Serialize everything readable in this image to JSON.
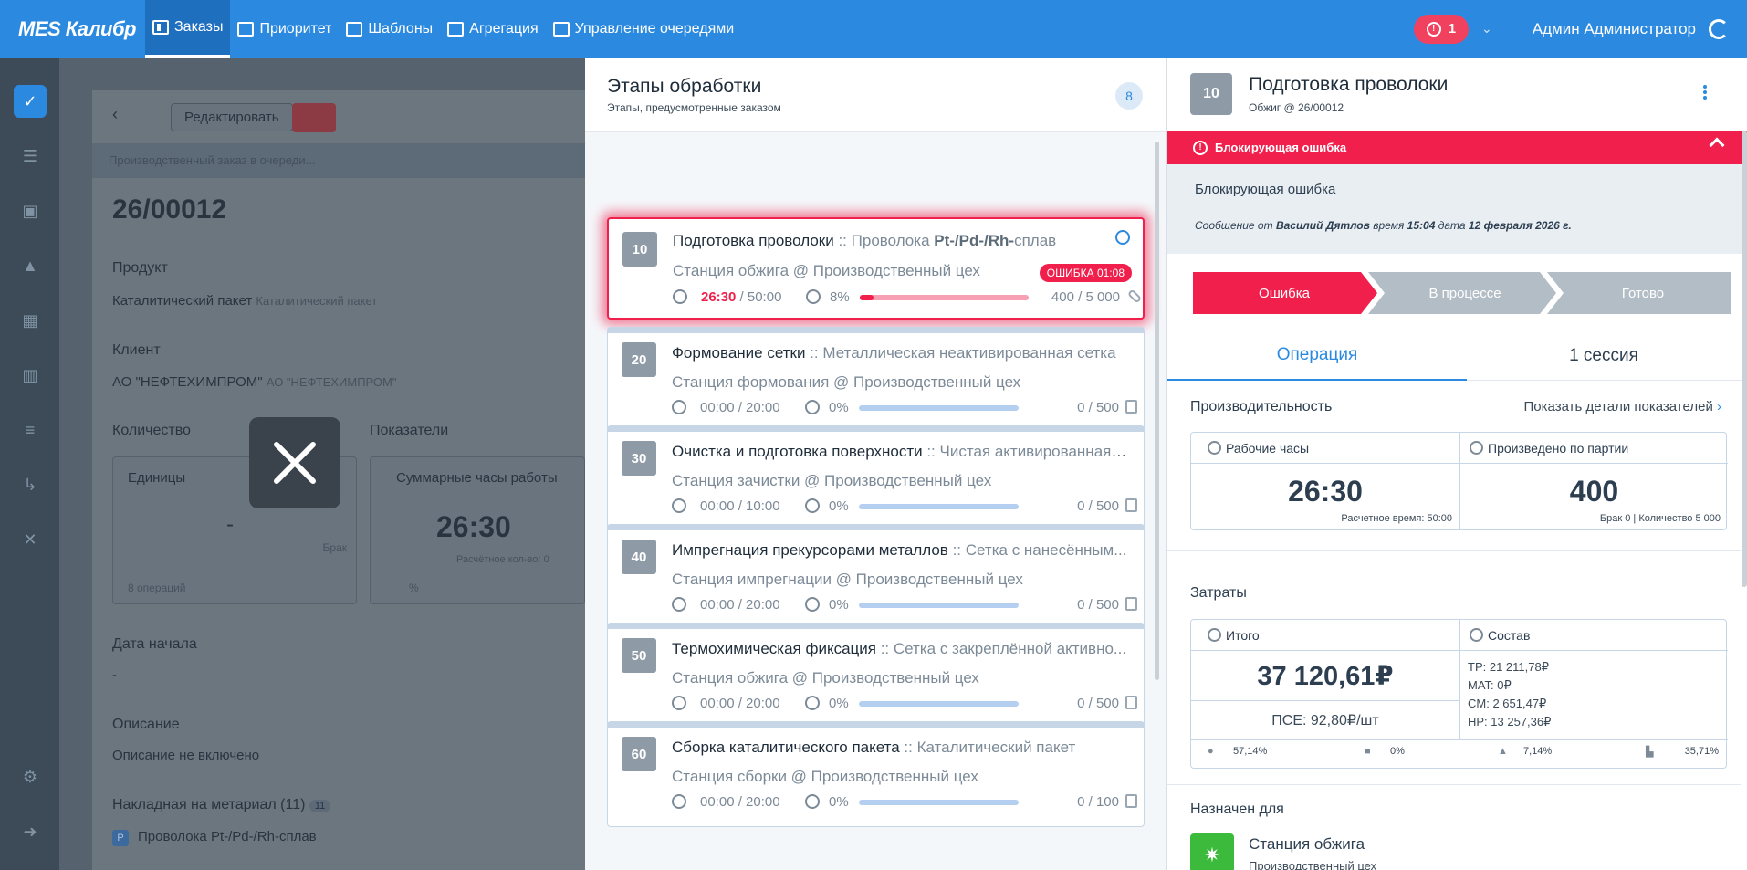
{
  "topbar": {
    "brand": "MES Калибр",
    "nav": [
      {
        "label": "Заказы",
        "active": true
      },
      {
        "label": "Приоритет"
      },
      {
        "label": "Шаблоны"
      },
      {
        "label": "Агрегация"
      },
      {
        "label": "Управление очередями"
      }
    ],
    "alert_count": "1",
    "user": "Админ Администратор"
  },
  "background": {
    "edit_label": "Редактировать",
    "status_band": "Производственный заказ в очереди...",
    "order_no": "26/00012",
    "product_label": "Продукт",
    "product_value": "Каталитический пакет",
    "product_value_muted": "Каталитический пакет",
    "client_label": "Клиент",
    "client_value": "АО \"НЕФТЕХИМПРОМ\"",
    "client_value_muted": "АО \"НЕФТЕХИМПРОМ\"",
    "quantity_label": "Количество",
    "units_label": "Единицы",
    "units_value": "-",
    "defect_label": "Брак",
    "ops_label": "8 операций",
    "metrics_label": "Показатели",
    "hours_label": "Суммарные часы работы",
    "hours_value": "26:30",
    "calc_label": "Расчётное кол-во: 0",
    "start_label": "Дата начала",
    "start_value": "-",
    "desc_label": "Описание",
    "desc_value": "Описание не включено",
    "bom_label": "Накладная на метариал (11)",
    "bom_count": "11",
    "bom_item": "Проволока Pt-/Pd-/Rh-сплав",
    "bom_item_badge": "P",
    "pct_label": "%"
  },
  "stages": {
    "title": "Этапы обработки",
    "subtitle": "Этапы, предусмотренные заказом",
    "count": "8",
    "items": [
      {
        "num": "10",
        "title": "Подготовка проволоки",
        "material_prefix": "Проволока ",
        "material_bold": "Pt-/Pd-/Rh-",
        "material_suffix": "сплав",
        "station": "Станция обжига @ Производственный цех",
        "time_cur": "26:30",
        "time_total": " / 50:00",
        "pct": "8%",
        "progress": 0.08,
        "qty": "400 / 5 000",
        "error": true,
        "error_badge": "ОШИБКА  01:08"
      },
      {
        "num": "20",
        "title": "Формование сетки",
        "material": "Металлическая неактивированная сетка",
        "station": "Станция формования @ Производственный цех",
        "time": "00:00 / 20:00",
        "pct": "0%",
        "progress": 0,
        "qty": "0 / 500"
      },
      {
        "num": "30",
        "title": "Очистка и подготовка поверхности",
        "material": "Чистая активированная ...",
        "station": "Станция зачистки @ Производственный цех",
        "time": "00:00 / 10:00",
        "pct": "0%",
        "progress": 0,
        "qty": "0 / 500"
      },
      {
        "num": "40",
        "title": "Импрегнация прекурсорами металлов",
        "material": "Сетка с нанесённым...",
        "station": "Станция импрегнации @ Производственный цех",
        "time": "00:00 / 20:00",
        "pct": "0%",
        "progress": 0,
        "qty": "0 / 500"
      },
      {
        "num": "50",
        "title": "Термохимическая фиксация",
        "material": "Сетка с закреплённой активно...",
        "station": "Станция обжига @ Производственный цех",
        "time": "00:00 / 20:00",
        "pct": "0%",
        "progress": 0,
        "qty": "0 / 500"
      },
      {
        "num": "60",
        "title": "Сборка каталитического пакета",
        "material": "Каталитический пакет",
        "station": "Станция сборки @ Производственный цех",
        "time": "00:00 / 20:00",
        "pct": "0%",
        "progress": 0,
        "qty": "0 / 100"
      }
    ]
  },
  "detail": {
    "num": "10",
    "title": "Подготовка проволоки",
    "subtitle": "Обжиг @ 26/00012",
    "error_band": "Блокирующая ошибка",
    "error_text": "Блокирующая ошибка",
    "msg_prefix": "Сообщение от ",
    "msg_author": "Василий Дятлов",
    "msg_time_label": " время ",
    "msg_time": "15:04",
    "msg_date_label": " дата ",
    "msg_date": "12 февраля 2026 г.",
    "steps": [
      "Ошибка",
      "В процессе",
      "Готово"
    ],
    "tabs": [
      "Операция",
      "1 сессия"
    ],
    "perf_title": "Производительность",
    "perf_link": "Показать детали показателей",
    "work_hours_label": "Рабочие часы",
    "work_hours_value": "26:30",
    "work_hours_note": "Расчетное время: 50:00",
    "produced_label": "Произведено по партии",
    "produced_value": "400",
    "produced_note": "Брак 0 | Количество 5 000",
    "costs_title": "Затраты",
    "total_label": "Итого",
    "total_value": "37 120,61₽",
    "pse": "ПСЕ: 92,80₽/шт",
    "composition_label": "Состав",
    "comp": [
      "TP: 21 211,78₽",
      "MAT: 0₽",
      "CM: 2 651,47₽",
      "HP: 13 257,36₽"
    ],
    "foot": [
      "57,14%",
      "0%",
      "7,14%",
      "35,71%"
    ],
    "assigned_title": "Назначен для",
    "assigned_station": "Станция обжига",
    "assigned_sub": "Производственный цех"
  },
  "colors": {
    "accent": "#2b8ae0",
    "error": "#f01f4b",
    "topbar": "#2b8ae0"
  }
}
